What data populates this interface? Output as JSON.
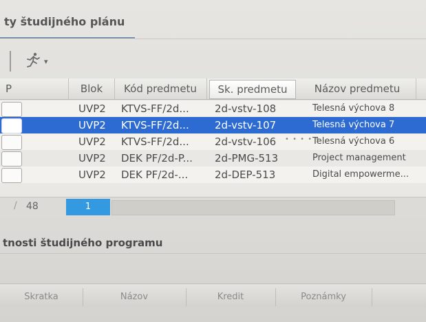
{
  "tab": {
    "title": "ty študijného plánu"
  },
  "toolbar": {
    "icon": "running-person-icon",
    "caret": "▾"
  },
  "table": {
    "headers": {
      "p": "P",
      "blok": "Blok",
      "kod": "Kód predmetu",
      "sk": "Sk. predmetu",
      "nazov": "Názov predmetu"
    },
    "rows": [
      {
        "blok": "UVP2",
        "kod": "KTVS-FF/2d...",
        "sk": "2d-vstv-108",
        "nazov": "Telesná výchova 8"
      },
      {
        "blok": "UVP2",
        "kod": "KTVS-FF/2d...",
        "sk": "2d-vstv-107",
        "nazov": "Telesná výchova 7"
      },
      {
        "blok": "UVP2",
        "kod": "KTVS-FF/2d...",
        "sk": "2d-vstv-106",
        "nazov": "Telesná výchova 6"
      },
      {
        "blok": "UVP2",
        "kod": "DEK PF/2d-P...",
        "sk": "2d-PMG-513",
        "nazov": "Project management"
      },
      {
        "blok": "UVP2",
        "kod": "DEK PF/2d-...",
        "sk": "2d-DEP-513",
        "nazov": "Digital empowerme..."
      }
    ],
    "selected_row": 1
  },
  "pager": {
    "separator": "/",
    "total": "48",
    "page": "1"
  },
  "lower": {
    "title": "tnosti študijného programu",
    "headers": {
      "skratka": "Skratka",
      "nazov": "Názov",
      "kredit": "Kredit",
      "poznamky": "Poznámky"
    }
  },
  "colors": {
    "selection": "#2d6bd3",
    "page_indicator": "#3399e0"
  }
}
